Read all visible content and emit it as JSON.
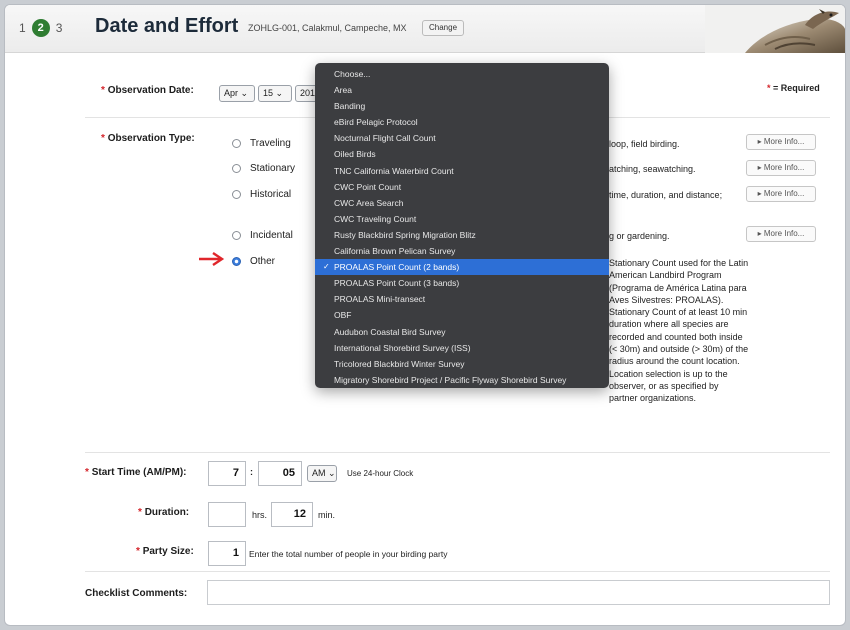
{
  "header": {
    "steps": [
      "1",
      "2",
      "3"
    ],
    "active_step": "2",
    "title": "Date and Effort",
    "location": "ZOHLG-001, Calakmul, Campeche, MX",
    "change_label": "Change"
  },
  "required_note": "= Required",
  "observation_date": {
    "label": "Observation Date:",
    "month": "Apr",
    "day": "15",
    "year": "201"
  },
  "observation_type": {
    "label": "Observation Type:",
    "options": [
      {
        "label": "Traveling",
        "desc": "loop, field birding.",
        "more": "More Info..."
      },
      {
        "label": "Stationary",
        "desc": "atching, seawatching.",
        "more": "More Info..."
      },
      {
        "label": "Historical",
        "desc": "time, duration, and distance;",
        "more": "More Info..."
      },
      {
        "label": "Incidental",
        "desc": "g or gardening.",
        "more": "More Info..."
      },
      {
        "label": "Other"
      }
    ],
    "other_desc": "Stationary Count used for the Latin American Landbird Program (Programa de América Latina para Aves Silvestres: PROALAS). Stationary Count of at least 10 min duration where all species are recorded and counted both inside (< 30m) and outside (> 30m) of the radius around the count location. Location selection is up to the observer, or as specified by partner organizations."
  },
  "dropdown": {
    "items": [
      "Choose...",
      "Area",
      "Banding",
      "eBird Pelagic Protocol",
      "Nocturnal Flight Call Count",
      "Oiled Birds",
      "TNC California Waterbird Count",
      "CWC Point Count",
      "CWC Area Search",
      "CWC Traveling Count",
      "Rusty Blackbird Spring Migration Blitz",
      "California Brown Pelican Survey",
      "PROALAS Point Count (2 bands)",
      "PROALAS Point Count (3 bands)",
      "PROALAS Mini-transect",
      "OBF",
      "Audubon Coastal Bird Survey",
      "International Shorebird Survey (ISS)",
      "Tricolored Blackbird Winter Survey",
      "Migratory Shorebird Project / Pacific Flyway Shorebird Survey"
    ],
    "selected": "PROALAS Point Count (2 bands)"
  },
  "start_time": {
    "label": "Start Time (AM/PM):",
    "hour": "7",
    "minute": "05",
    "ampm": "AM",
    "clock_link": "Use 24-hour Clock"
  },
  "duration": {
    "label": "Duration:",
    "hours": "",
    "hrs_label": "hrs.",
    "minutes": "12",
    "min_label": "min."
  },
  "party_size": {
    "label": "Party Size:",
    "value": "1",
    "hint": "Enter the total number of people in your birding party"
  },
  "comments": {
    "label": "Checklist Comments:"
  },
  "colors": {
    "accent_green": "#2f7d32",
    "required_red": "#d4242a",
    "dropdown_bg": "#3c3d40",
    "selected_blue": "#2d6fd6"
  }
}
